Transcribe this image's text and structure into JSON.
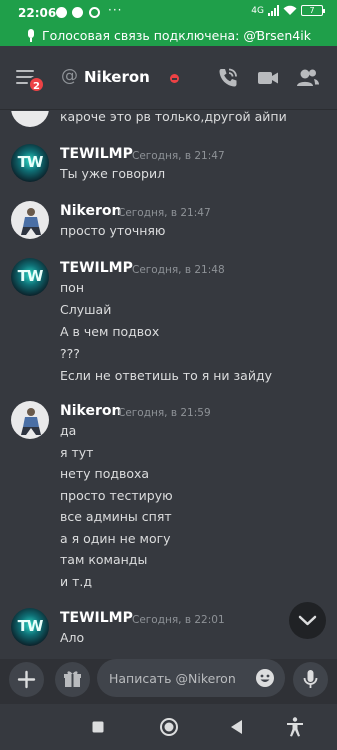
{
  "status_bar": {
    "time": "22:06",
    "more": "···",
    "network": "4G",
    "battery": "7",
    "voice_banner": "Голосовая связь подключена: @Ɓrsen4ik",
    "bg_color": "#1f9f4a",
    "icons": [
      "discord-icon",
      "discord-icon",
      "sync-icon",
      "signal-icon",
      "wifi-icon",
      "battery-icon",
      "microphone-icon"
    ]
  },
  "header": {
    "menu_badge": "2",
    "at_symbol": "@",
    "channel_name": "Nikeron",
    "status": "dnd",
    "icons": [
      "menu-icon",
      "at-icon",
      "phone-call-icon",
      "video-camera-icon",
      "members-icon"
    ]
  },
  "messages": {
    "partial_line": "кароче это рв только,другой айпи",
    "groups": [
      {
        "author": "TEWILMP",
        "timestamp": "Сегодня, в 21:47",
        "avatar_text": "TW",
        "lines": [
          "Ты уже говорил"
        ]
      },
      {
        "author": "Nikeron",
        "timestamp": "Сегодня, в 21:47",
        "lines": [
          "просто уточняю"
        ]
      },
      {
        "author": "TEWILMP",
        "timestamp": "Сегодня, в 21:48",
        "avatar_text": "TW",
        "lines": [
          "пон",
          "Слушай",
          "А в чем подвох",
          "???",
          "Если не ответишь то я ни зайду"
        ]
      },
      {
        "author": "Nikeron",
        "timestamp": "Сегодня, в 21:59",
        "lines": [
          "да",
          "я тут",
          "нету подвоха",
          "просто тестирую",
          "все админы спят",
          "а я один не могу",
          "там команды",
          "и т.д"
        ]
      },
      {
        "author": "TEWILMP",
        "timestamp": "Сегодня, в 22:01",
        "avatar_text": "TW",
        "lines": [
          "Ало"
        ]
      }
    ]
  },
  "composer": {
    "placeholder": "Написать @Nikeron",
    "icons": [
      "plus-icon",
      "gift-icon",
      "emoji-icon",
      "microphone-icon",
      "chevron-down-icon"
    ]
  },
  "navbar": {
    "icons": [
      "recents-square-icon",
      "home-circle-icon",
      "back-triangle-icon",
      "accessibility-icon"
    ]
  },
  "colors": {
    "background": "#36393f",
    "composer_bg": "#2f3136",
    "input_bg": "#40444b",
    "muted_text": "#8e9297",
    "badge_red": "#ed4245"
  }
}
